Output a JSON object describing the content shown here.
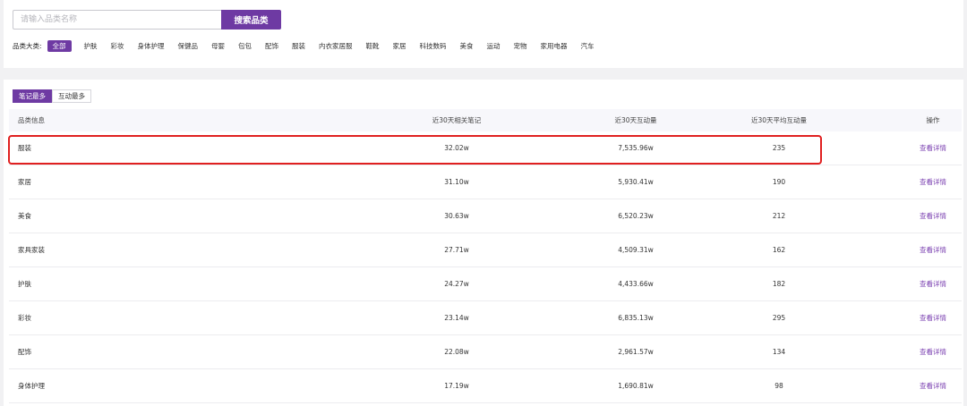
{
  "search": {
    "placeholder": "请输入品类名称",
    "button_label": "搜索品类"
  },
  "categories": {
    "label": "品类大类:",
    "items": [
      "全部",
      "护肤",
      "彩妆",
      "身体护理",
      "保健品",
      "母婴",
      "包包",
      "配饰",
      "服装",
      "内衣家居服",
      "鞋靴",
      "家居",
      "科技数码",
      "美食",
      "运动",
      "宠物",
      "家用电器",
      "汽车"
    ],
    "active": "全部"
  },
  "sort_tabs": [
    "笔记最多",
    "互动最多"
  ],
  "table": {
    "headers": [
      "品类信息",
      "近30天相关笔记",
      "近30天互动量",
      "近30天平均互动量",
      "操作"
    ],
    "rows": [
      {
        "name": "服装",
        "notes": "32.02w",
        "interactions": "7,535.96w",
        "avg": "235",
        "action": "查看详情"
      },
      {
        "name": "家居",
        "notes": "31.10w",
        "interactions": "5,930.41w",
        "avg": "190",
        "action": "查看详情"
      },
      {
        "name": "美食",
        "notes": "30.63w",
        "interactions": "6,520.23w",
        "avg": "212",
        "action": "查看详情"
      },
      {
        "name": "家具家装",
        "notes": "27.71w",
        "interactions": "4,509.31w",
        "avg": "162",
        "action": "查看详情"
      },
      {
        "name": "护肤",
        "notes": "24.27w",
        "interactions": "4,433.66w",
        "avg": "182",
        "action": "查看详情"
      },
      {
        "name": "彩妆",
        "notes": "23.14w",
        "interactions": "6,835.13w",
        "avg": "295",
        "action": "查看详情"
      },
      {
        "name": "配饰",
        "notes": "22.08w",
        "interactions": "2,961.57w",
        "avg": "134",
        "action": "查看详情"
      },
      {
        "name": "身体护理",
        "notes": "17.19w",
        "interactions": "1,690.81w",
        "avg": "98",
        "action": "查看详情"
      }
    ]
  },
  "colors": {
    "accent": "#6e3aa3",
    "link": "#7a3fb0",
    "highlight": "#e02020"
  }
}
